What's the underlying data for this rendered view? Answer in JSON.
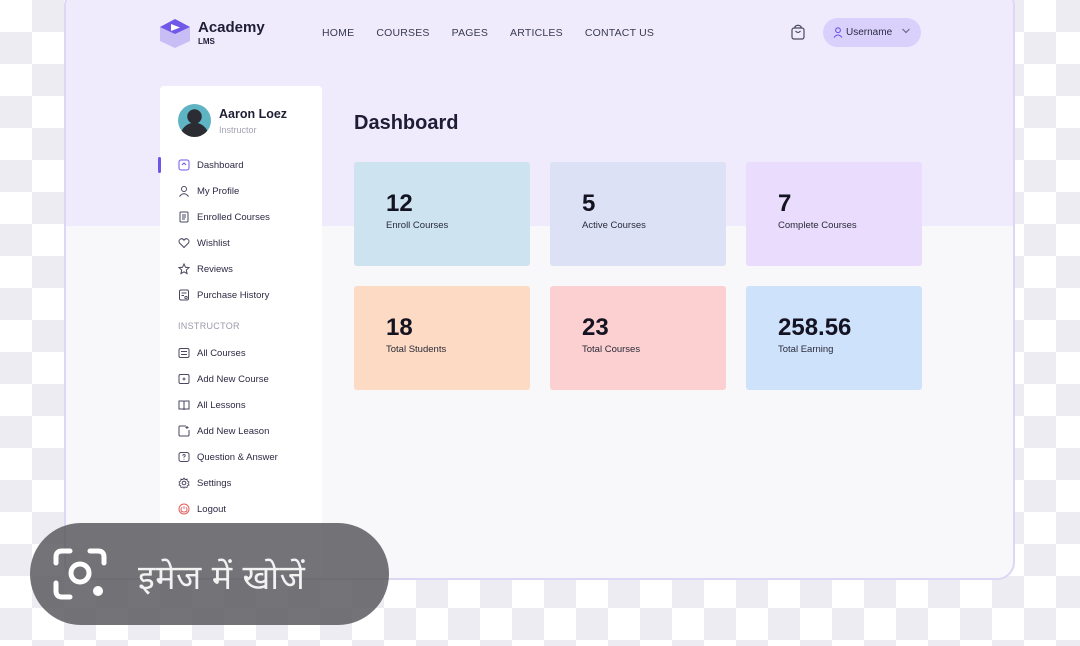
{
  "app": {
    "name": "Academy",
    "sub": "LMS"
  },
  "nav": [
    "HOME",
    "COURSES",
    "PAGES",
    "ARTICLES",
    "CONTACT US"
  ],
  "user": {
    "label": "Username"
  },
  "profile": {
    "name": "Aaron Loez",
    "role": "Instructor"
  },
  "sidebar": {
    "items": [
      "Dashboard",
      "My Profile",
      "Enrolled Courses",
      "Wishlist",
      "Reviews",
      "Purchase History"
    ],
    "section": "INSTRUCTOR",
    "instructor_items": [
      "All Courses",
      "Add New Course",
      "All Lessons",
      "Add New Leason",
      "Question & Answer",
      "Settings",
      "Logout"
    ]
  },
  "main": {
    "title": "Dashboard"
  },
  "stats": [
    {
      "value": "12",
      "label": "Enroll Courses",
      "color": "#cde3f0"
    },
    {
      "value": "5",
      "label": "Active Courses",
      "color": "#dde1f6"
    },
    {
      "value": "7",
      "label": "Complete Courses",
      "color": "#e9dcfc"
    },
    {
      "value": "18",
      "label": "Total Students",
      "color": "#fcdac4"
    },
    {
      "value": "23",
      "label": "Total Courses",
      "color": "#fcd0d0"
    },
    {
      "value": "258.56",
      "label": "Total Earning",
      "color": "#cfe2fc"
    }
  ],
  "lens": {
    "text": "इमेज में खोजें"
  },
  "colors": {
    "accent": "#6c56e8",
    "logout": "#e25c5c"
  }
}
